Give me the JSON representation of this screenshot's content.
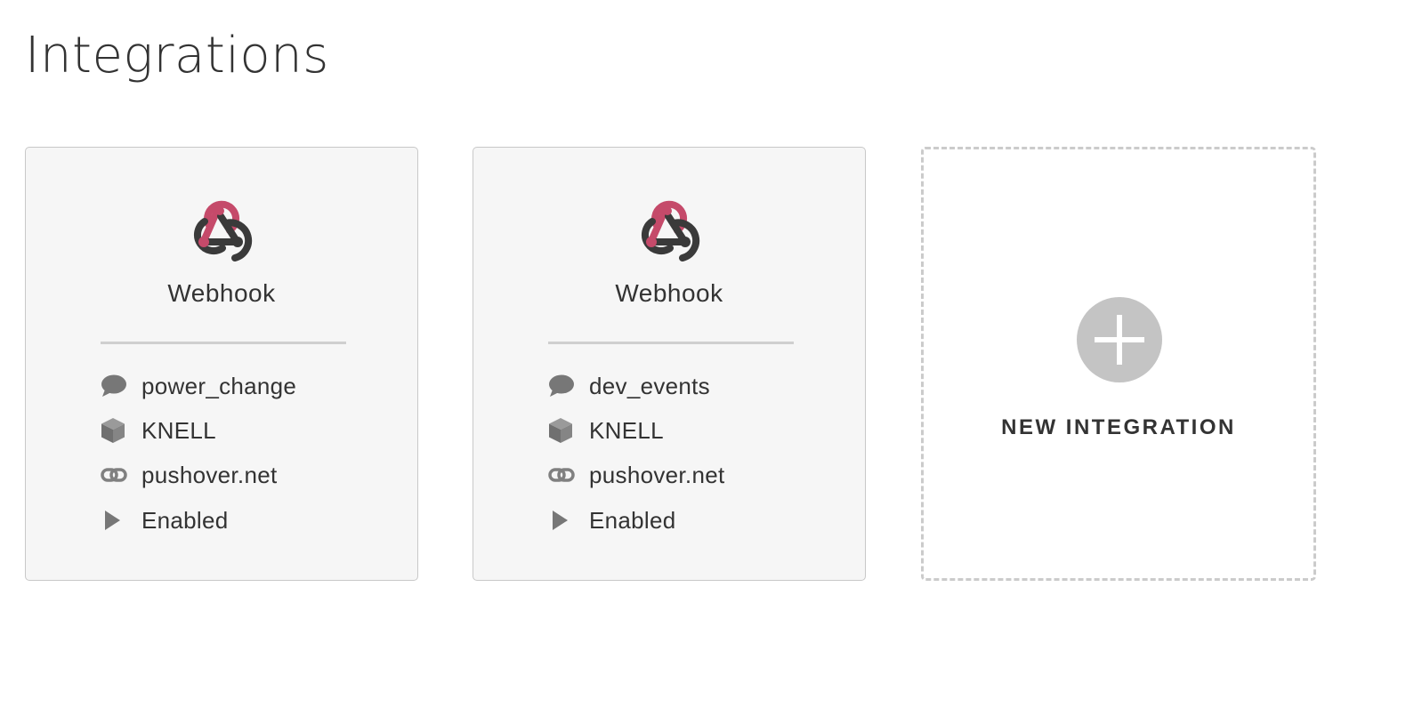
{
  "page": {
    "title": "Integrations"
  },
  "integrations": [
    {
      "type": "Webhook",
      "icon": "webhook-icon",
      "event": "power_change",
      "device": "KNELL",
      "url": "pushover.net",
      "status": "Enabled"
    },
    {
      "type": "Webhook",
      "icon": "webhook-icon",
      "event": "dev_events",
      "device": "KNELL",
      "url": "pushover.net",
      "status": "Enabled"
    }
  ],
  "new_integration": {
    "label": "NEW INTEGRATION",
    "icon": "plus-icon"
  },
  "colors": {
    "webhook_accent": "#c54a6a",
    "webhook_dark": "#3a3a3a",
    "card_background": "#f6f6f6",
    "card_border": "#c8c8c8",
    "icon_gray": "#777777",
    "plus_circle": "#c4c4c4"
  }
}
